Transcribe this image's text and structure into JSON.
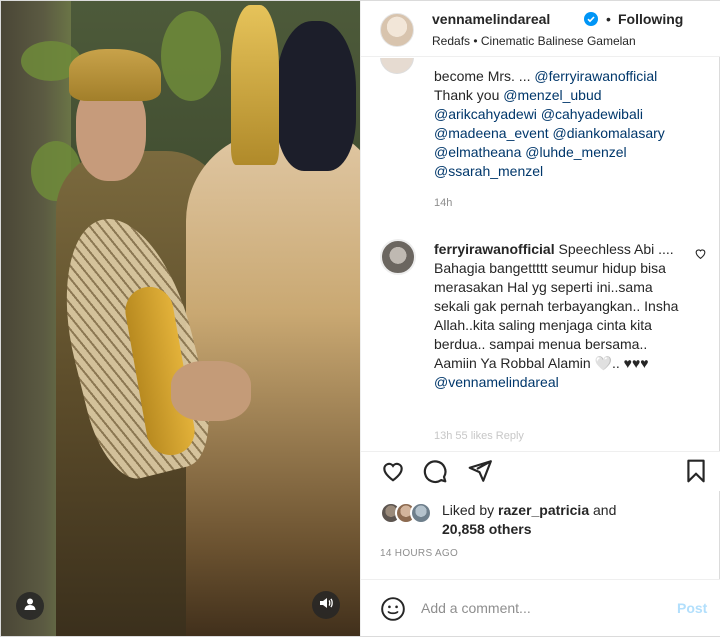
{
  "header": {
    "username": "vennamelindareal",
    "separator": "•",
    "follow_status": "Following",
    "subtitle": "Redafs • Cinematic Balinese Gamelan"
  },
  "caption": {
    "line1": "become Mrs. ... ",
    "mention_a": "@ferryirawanofficial",
    "line2": "Thank you ",
    "mention_b": "@menzel_ubud",
    "mention_c": "@arikcahyadewi",
    "mention_d": "@cahyadewibali",
    "mention_e": "@madeena_event",
    "mention_f": "@diankomalasary",
    "mention_g": "@elmatheana",
    "mention_h": "@luhde_menzel",
    "mention_i": "@ssarah_menzel",
    "time": "14h"
  },
  "comment": {
    "username": "ferryirawanofficial",
    "text": "Speechless Abi .... Bahagia bangettttt seumur hidup bisa merasakan Hal yg seperti ini..sama sekali gak pernah terbayangkan.. Insha Allah..kita saling menjaga cinta kita berdua.. sampai menua bersama.. Aamiin Ya Robbal Alamin",
    "emojis": "🤍.. ♥♥♥",
    "mention": "@vennamelindareal",
    "meta": "13h 55 likes Reply"
  },
  "likes": {
    "prefix": "Liked by ",
    "user": "razer_patricia",
    "and": " and",
    "count": "20,858 others"
  },
  "timeago": "14 HOURS AGO",
  "add_comment": {
    "placeholder": "Add a comment...",
    "post_label": "Post"
  },
  "colors": {
    "link": "#00376b",
    "verified": "#0095f6",
    "post_disabled": "#b2dffc"
  },
  "icons": [
    "user-tag-icon",
    "sound-icon",
    "verified-icon",
    "heart-icon",
    "comment-icon",
    "share-icon",
    "bookmark-icon",
    "emoji-icon"
  ]
}
